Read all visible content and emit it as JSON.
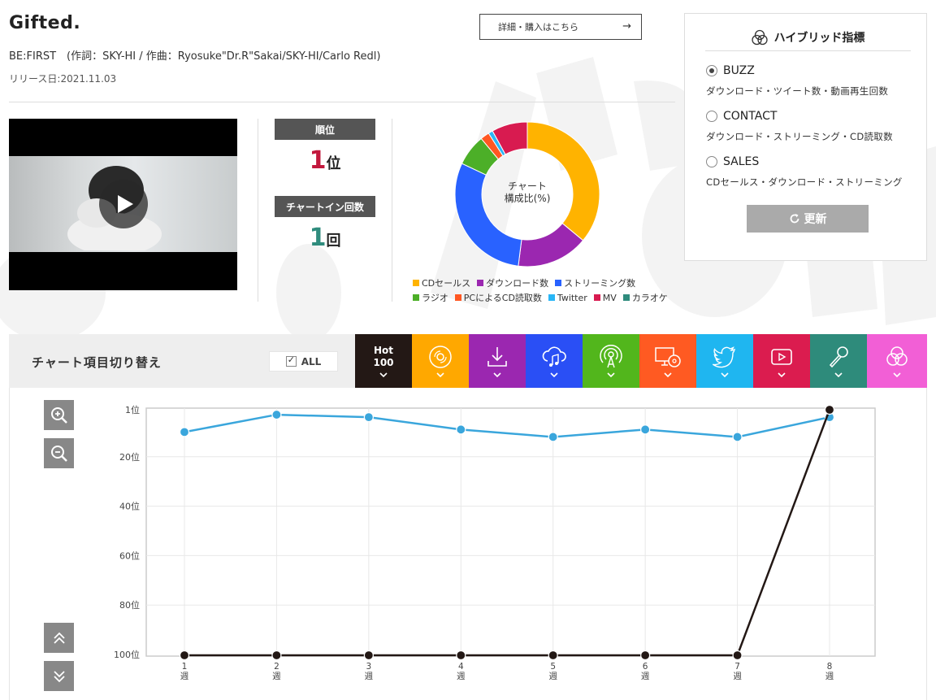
{
  "song": {
    "title": "Gifted.",
    "credits": "BE:FIRST　(作詞：SKY-HI / 作曲：Ryosuke\"Dr.R\"Sakai/SKY-HI/Carlo Redl)",
    "release": "リリース日:2021.11.03"
  },
  "detail_button": {
    "label": "詳細・購入はこちら",
    "arrow": "→"
  },
  "video": {
    "play_icon": "play-icon"
  },
  "stats": {
    "rank_label": "順位",
    "rank_value": "1",
    "rank_unit": "位",
    "chartin_label": "チャートイン回数",
    "chartin_value": "1",
    "chartin_unit": "回"
  },
  "donut": {
    "center_line1": "チャート",
    "center_line2": "構成比(%)",
    "segments": [
      {
        "name": "CDセールス",
        "value": 36,
        "color": "#ffb300"
      },
      {
        "name": "ダウンロード数",
        "value": 16,
        "color": "#9b27b0"
      },
      {
        "name": "ストリーミング数",
        "value": 30,
        "color": "#2962ff"
      },
      {
        "name": "ラジオ",
        "value": 7,
        "color": "#4caf28"
      },
      {
        "name": "PCによるCD読取数",
        "value": 2,
        "color": "#ff5722"
      },
      {
        "name": "Twitter",
        "value": 1,
        "color": "#29b6f6"
      },
      {
        "name": "MV",
        "value": 8,
        "color": "#d81b50"
      },
      {
        "name": "カラオケ",
        "value": 0,
        "color": "#2f8c7d"
      }
    ]
  },
  "hybrid": {
    "title": "ハイブリッド指標",
    "options": [
      {
        "label": "BUZZ",
        "desc": "ダウンロード・ツイート数・動画再生回数",
        "selected": true
      },
      {
        "label": "CONTACT",
        "desc": "ダウンロード・ストリーミング・CD読取数",
        "selected": false
      },
      {
        "label": "SALES",
        "desc": "CDセールス・ダウンロード・ストリーミング",
        "selected": false
      }
    ],
    "update_label": "更新"
  },
  "switcher": {
    "title": "チャート項目切り替え",
    "all_label": "ALL",
    "hot_line1": "Hot",
    "hot_line2": "100",
    "tabs": [
      {
        "name": "hot100",
        "color": "#231815"
      },
      {
        "name": "cd",
        "color": "#ffa800"
      },
      {
        "name": "download",
        "color": "#9b27b0"
      },
      {
        "name": "streaming",
        "color": "#2a4ff5"
      },
      {
        "name": "radio",
        "color": "#52b61c"
      },
      {
        "name": "pc-read",
        "color": "#ff5a22"
      },
      {
        "name": "twitter",
        "color": "#1fb6f0"
      },
      {
        "name": "mv",
        "color": "#db1c4f"
      },
      {
        "name": "karaoke",
        "color": "#2e8b7b"
      },
      {
        "name": "hybrid",
        "color": "#f25fd6"
      }
    ]
  },
  "chart_data": {
    "type": "line",
    "x": [
      1,
      2,
      3,
      4,
      5,
      6,
      7,
      8
    ],
    "x_tick_labels": [
      "1\n週",
      "2\n週",
      "3\n週",
      "4\n週",
      "5\n週",
      "6\n週",
      "7\n週",
      "8\n週"
    ],
    "y_tick_labels": [
      "1位",
      "20位",
      "40位",
      "60位",
      "80位",
      "100位"
    ],
    "y_ticks": [
      1,
      20,
      40,
      60,
      80,
      100
    ],
    "ylim": [
      100,
      1
    ],
    "y_inverted": true,
    "grid": true,
    "series": [
      {
        "values": [
          10,
          3,
          4,
          9,
          12,
          9,
          12,
          4
        ],
        "color": "#3aa6dc"
      },
      {
        "values": [
          101,
          101,
          101,
          101,
          101,
          101,
          101,
          1
        ],
        "color": "#231815"
      }
    ]
  }
}
